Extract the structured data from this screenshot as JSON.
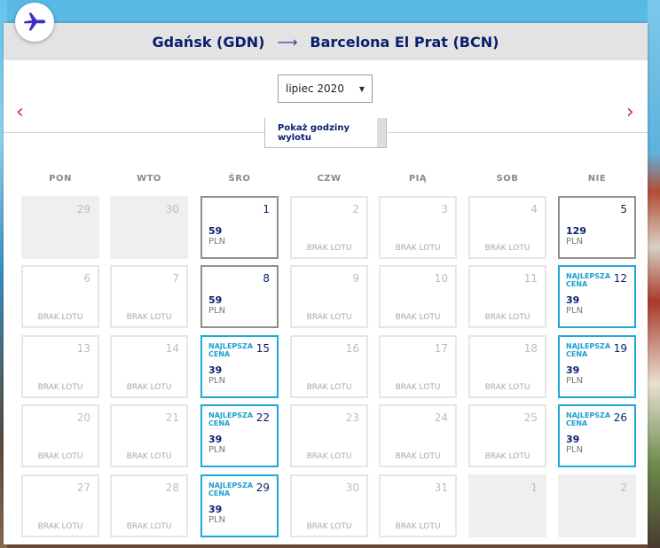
{
  "route": {
    "origin": "Gdańsk (GDN)",
    "arrow": "⟶",
    "destination": "Barcelona El Prat (BCN)"
  },
  "colors": {
    "accent": "#c0247f",
    "navy": "#0a1e6e",
    "best": "#20a8d8"
  },
  "icons": {
    "logo": "airplane-icon",
    "prev": "chevron-left-icon",
    "next": "chevron-right-icon",
    "select": "caret-down-icon"
  },
  "nav": {
    "prev": "‹",
    "next": "›"
  },
  "month_select": {
    "value": "lipiec 2020",
    "caret": "▼"
  },
  "hours_button": {
    "label": "Pokaż godziny wylotu"
  },
  "weekdays": [
    "PON",
    "WTO",
    "ŚRO",
    "CZW",
    "PIĄ",
    "SOB",
    "NIE"
  ],
  "no_flight_label": "BRAK LOTU",
  "best_label": "NAJLEPSZA CENA",
  "calendar": [
    {
      "day": "29",
      "state": "outside"
    },
    {
      "day": "30",
      "state": "outside"
    },
    {
      "day": "1",
      "state": "avail",
      "price": "59",
      "currency": "PLN"
    },
    {
      "day": "2",
      "state": "none"
    },
    {
      "day": "3",
      "state": "none"
    },
    {
      "day": "4",
      "state": "none"
    },
    {
      "day": "5",
      "state": "avail",
      "price": "129",
      "currency": "PLN"
    },
    {
      "day": "6",
      "state": "none"
    },
    {
      "day": "7",
      "state": "none"
    },
    {
      "day": "8",
      "state": "avail",
      "price": "59",
      "currency": "PLN"
    },
    {
      "day": "9",
      "state": "none"
    },
    {
      "day": "10",
      "state": "none"
    },
    {
      "day": "11",
      "state": "none"
    },
    {
      "day": "12",
      "state": "best",
      "price": "39",
      "currency": "PLN"
    },
    {
      "day": "13",
      "state": "none"
    },
    {
      "day": "14",
      "state": "none"
    },
    {
      "day": "15",
      "state": "best",
      "price": "39",
      "currency": "PLN"
    },
    {
      "day": "16",
      "state": "none"
    },
    {
      "day": "17",
      "state": "none"
    },
    {
      "day": "18",
      "state": "none"
    },
    {
      "day": "19",
      "state": "best",
      "price": "39",
      "currency": "PLN"
    },
    {
      "day": "20",
      "state": "none"
    },
    {
      "day": "21",
      "state": "none"
    },
    {
      "day": "22",
      "state": "best",
      "price": "39",
      "currency": "PLN"
    },
    {
      "day": "23",
      "state": "none"
    },
    {
      "day": "24",
      "state": "none"
    },
    {
      "day": "25",
      "state": "none"
    },
    {
      "day": "26",
      "state": "best",
      "price": "39",
      "currency": "PLN"
    },
    {
      "day": "27",
      "state": "none"
    },
    {
      "day": "28",
      "state": "none"
    },
    {
      "day": "29",
      "state": "best",
      "price": "39",
      "currency": "PLN"
    },
    {
      "day": "30",
      "state": "none"
    },
    {
      "day": "31",
      "state": "none"
    },
    {
      "day": "1",
      "state": "outside"
    },
    {
      "day": "2",
      "state": "outside"
    }
  ]
}
